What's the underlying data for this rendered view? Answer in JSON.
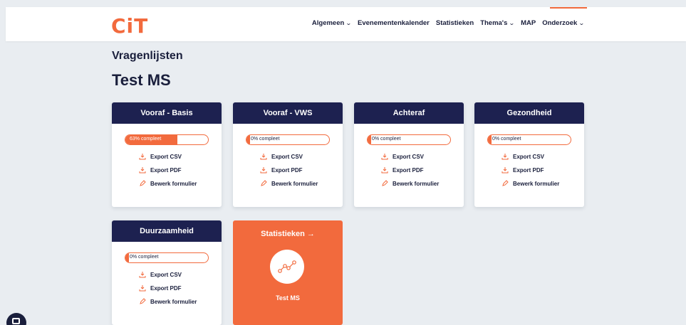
{
  "brand": {
    "logo": "CiT",
    "accent": "#f26a3d",
    "navy": "#1d2150"
  },
  "nav": {
    "items": [
      {
        "label": "Algemeen",
        "dropdown": true
      },
      {
        "label": "Evenementenkalender",
        "dropdown": false
      },
      {
        "label": "Statistieken",
        "dropdown": false
      },
      {
        "label": "Thema's",
        "dropdown": true
      },
      {
        "label": "MAP",
        "dropdown": false
      },
      {
        "label": "Onderzoek",
        "dropdown": true
      }
    ],
    "dropdown_glyph": "⌄"
  },
  "page": {
    "breadcrumb": "Vragenlijsten",
    "title": "Test MS"
  },
  "cards": [
    {
      "title": "Vooraf - Basis",
      "progress_label": "63% compleet",
      "progress": 0.63
    },
    {
      "title": "Vooraf - VWS",
      "progress_label": "0% compleet",
      "progress": 0.0
    },
    {
      "title": "Achteraf",
      "progress_label": "0% compleet",
      "progress": 0.0
    },
    {
      "title": "Gezondheid",
      "progress_label": "0% compleet",
      "progress": 0.0
    },
    {
      "title": "Duurzaamheid",
      "progress_label": "0% compleet",
      "progress": 0.0
    }
  ],
  "actions": {
    "export_csv": "Export CSV",
    "export_pdf": "Export PDF",
    "edit_form": "Bewerk formulier"
  },
  "stats_card": {
    "link_label": "Statistieken →",
    "name": "Test MS"
  }
}
